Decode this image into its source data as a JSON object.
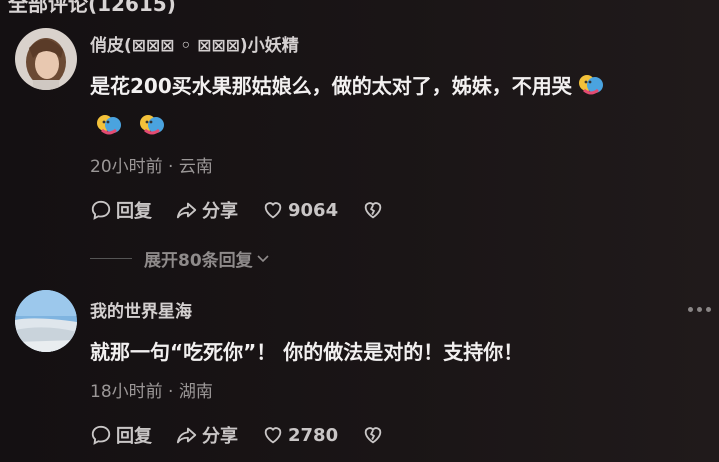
{
  "header": {
    "title": "全部评论(12615)"
  },
  "comments": [
    {
      "username": "俏皮(⊠⊠⊠ ◦ ⊠⊠⊠)小妖精",
      "text": "是花200买水果那姑娘么，做的太对了，姊妹，不用哭",
      "emojis": [
        "hug-emoji",
        "hug-emoji",
        "hug-emoji"
      ],
      "meta": "20小时前 · 云南",
      "reply_label": "回复",
      "share_label": "分享",
      "likes": "9064",
      "expand_label": "展开80条回复"
    },
    {
      "username": "我的世界星海",
      "text": "就那一句“吃死你”！ 你的做法是对的！支持你！",
      "meta": "18小时前 · 湖南",
      "reply_label": "回复",
      "share_label": "分享",
      "likes": "2780"
    }
  ],
  "colors": {
    "background": "#1a1516",
    "text": "#f2f0f0",
    "muted": "#9b9797"
  },
  "icons": [
    "comment-icon",
    "share-icon",
    "heart-icon",
    "broken-heart-icon",
    "chevron-down-icon",
    "more-icon"
  ]
}
